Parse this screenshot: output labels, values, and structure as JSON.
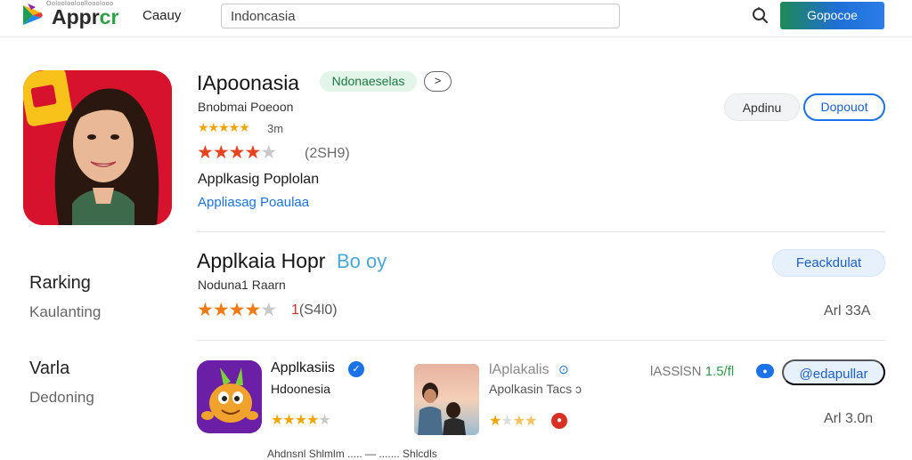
{
  "header": {
    "logo_tagline": "Ooloolooloollooolooo",
    "logo_text_main": "Appr",
    "logo_text_accent": "cr",
    "nav_link": "Caauy",
    "search_value": "Indoncasia",
    "action_button": "Gopocoe"
  },
  "featured_app": {
    "title": "IApoonasia",
    "chip_label": "Ndonaeselas",
    "chip_arrow": ">",
    "developer": "Bnobmai Poeoon",
    "small_stars": "★★★★★",
    "small_note": "3m",
    "stars": "★★★★★",
    "rating_count": "(2SH9)",
    "description": "Applkasig Poplolan",
    "link_text": "Appliasag Poaulaa",
    "button_secondary": "Apdinu",
    "button_primary": "Dopouot"
  },
  "side_sections": [
    {
      "heading": "Rarking",
      "sub": "Kaulanting"
    },
    {
      "heading": "Varla",
      "sub": "Dedoning"
    }
  ],
  "ranking_section": {
    "title": "Applkaia Hopr",
    "title_accent": "Bo oy",
    "developer": "Noduna1 Raarn",
    "stars": "★★★★★",
    "count_prefix": "1",
    "count": "(S4l0)",
    "button": "Feackdulat",
    "right_meta": "Arl 33A"
  },
  "cards": [
    {
      "title": "Applkasiis",
      "verified_mark": "✓",
      "subtitle": "Hdoonesia",
      "stars": "★★★★★"
    },
    {
      "title": "lAplakalis",
      "title_icon": "⊙",
      "subtitle": "Apolkasin Tacs",
      "subtitle_tail": "ɔ",
      "stars": "★★★★★",
      "badge": "●"
    },
    {
      "meta_left": "lASSlSN",
      "meta_accent": "1.5/fl",
      "badge": "●",
      "button": "@edapullar",
      "right_meta": "Arl 3.0n"
    }
  ],
  "cut_row_text": "Ahdnsnl Shlmlm ..... — ....... Shlcdls",
  "colors": {
    "accent_blue": "#1a73e8",
    "accent_green": "#2ea043",
    "star_red": "#e8431f",
    "star_gold": "#f2a500",
    "icon_red": "#d8102a"
  }
}
